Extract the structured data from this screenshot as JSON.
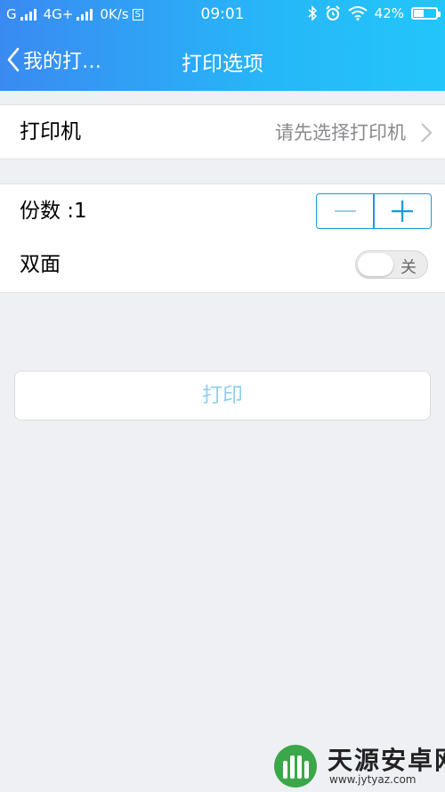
{
  "status_bar": {
    "carrier1": "G",
    "carrier2": "4G+",
    "speed": "0K/s",
    "sim_badge": "S",
    "time": "09:01",
    "battery": "42%"
  },
  "nav": {
    "back_label": "我的打…",
    "title": "打印选项"
  },
  "printer_row": {
    "label": "打印机",
    "value": "请先选择打印机"
  },
  "copies_row": {
    "label": "份数 :1",
    "copies": 1
  },
  "duplex_row": {
    "label": "双面",
    "toggle_label": "关",
    "enabled": false
  },
  "print_button": {
    "label": "打印"
  },
  "colors": {
    "accent": "#1a9ae0",
    "header_start": "#3a8af2",
    "header_end": "#22c6fb",
    "disabled_text": "#8fd0ee"
  },
  "watermark": {
    "title": "天源安卓网",
    "url": "www.jytyaz.com"
  }
}
